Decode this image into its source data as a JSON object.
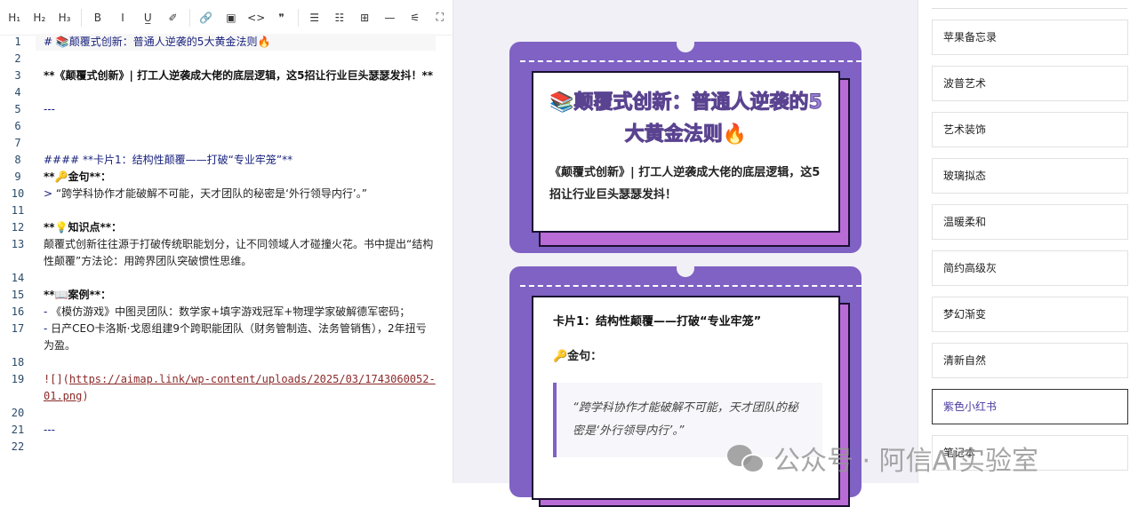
{
  "toolbar": [
    {
      "name": "h1-button",
      "label": "H₁"
    },
    {
      "name": "h2-button",
      "label": "H₂"
    },
    {
      "name": "h3-button",
      "label": "H₃"
    },
    {
      "sep": true
    },
    {
      "name": "bold-button",
      "label": "B"
    },
    {
      "name": "italic-button",
      "label": "I"
    },
    {
      "name": "underline-button",
      "label": "U̲"
    },
    {
      "name": "strikethrough-button",
      "label": "✐"
    },
    {
      "sep": true
    },
    {
      "name": "link-button",
      "label": "🔗"
    },
    {
      "name": "image-button",
      "label": "▣"
    },
    {
      "name": "code-button",
      "label": "<>"
    },
    {
      "name": "quote-button",
      "label": "❞"
    },
    {
      "sep": true
    },
    {
      "name": "bullet-list-button",
      "label": "☰"
    },
    {
      "name": "ordered-list-button",
      "label": "☷"
    },
    {
      "name": "table-button",
      "label": "⊞"
    },
    {
      "name": "divider-button",
      "label": "—"
    },
    {
      "name": "settings-button",
      "label": "⚟"
    },
    {
      "name": "fullscreen-button",
      "label": "⛶"
    }
  ],
  "editor_lines": [
    {
      "num": "1",
      "parts": [
        {
          "c": "h",
          "t": "# 📚颠覆式创新：普通人逆袭的5大黄金法则🔥"
        }
      ],
      "cur": true
    },
    {
      "num": "2",
      "parts": []
    },
    {
      "num": "3",
      "parts": [
        {
          "c": "b",
          "t": "**《颠覆式创新》| 打工人逆袭成大佬的底层逻辑，这5招让行业巨头瑟瑟发抖！**"
        }
      ]
    },
    {
      "num": "4",
      "parts": []
    },
    {
      "num": "5",
      "parts": [
        {
          "c": "hr",
          "t": "---"
        }
      ]
    },
    {
      "num": "6",
      "parts": []
    },
    {
      "num": "7",
      "parts": []
    },
    {
      "num": "8",
      "parts": [
        {
          "c": "h",
          "t": "#### **卡片1：结构性颠覆——打破“专业牢笼”**"
        }
      ]
    },
    {
      "num": "9",
      "parts": [
        {
          "c": "b",
          "t": "**🔑金句**："
        }
      ]
    },
    {
      "num": "10",
      "parts": [
        {
          "c": "h",
          "t": "> "
        },
        {
          "c": "q",
          "t": "“跨学科协作才能破解不可能，天才团队的秘密是‘外行领导内行’。”"
        }
      ]
    },
    {
      "num": "11",
      "parts": []
    },
    {
      "num": "12",
      "parts": [
        {
          "c": "b",
          "t": "**💡知识点**："
        }
      ]
    },
    {
      "num": "13",
      "parts": [
        {
          "c": "q",
          "t": "颠覆式创新往往源于打破传统职能划分，让不同领域人才碰撞火花。书中提出“结构性颠覆”方法论：用跨界团队突破惯性思维。"
        }
      ]
    },
    {
      "num": "14",
      "parts": []
    },
    {
      "num": "15",
      "parts": [
        {
          "c": "b",
          "t": "**📖案例**："
        }
      ]
    },
    {
      "num": "16",
      "parts": [
        {
          "c": "h",
          "t": "- "
        },
        {
          "c": "q",
          "t": "《模仿游戏》中图灵团队：数学家+填字游戏冠军+物理学家破解德军密码；"
        }
      ]
    },
    {
      "num": "17",
      "parts": [
        {
          "c": "h",
          "t": "- "
        },
        {
          "c": "q",
          "t": "日产CEO卡洛斯·戈恩组建9个跨职能团队（财务管制造、法务管销售），2年扭亏为盈。"
        }
      ]
    },
    {
      "num": "18",
      "parts": []
    },
    {
      "num": "19",
      "parts": [
        {
          "c": "urlp",
          "t": "![]("
        },
        {
          "c": "url",
          "t": "https://aimap.link/wp-content/uploads/2025/03/1743060052-01.png"
        },
        {
          "c": "urlp",
          "t": ")"
        }
      ]
    },
    {
      "num": "20",
      "parts": []
    },
    {
      "num": "21",
      "parts": [
        {
          "c": "hr",
          "t": "---"
        }
      ]
    },
    {
      "num": "22",
      "parts": []
    }
  ],
  "preview": {
    "card1": {
      "title": "📚颠覆式创新：普通人逆袭的5大黄金法则🔥",
      "subtitle": "《颠覆式创新》| 打工人逆袭成大佬的底层逻辑，这5招让行业巨头瑟瑟发抖！"
    },
    "card2": {
      "title": "卡片1：结构性颠覆——打破“专业牢笼”",
      "gold_label": "🔑金句：",
      "quote": "“跨学科协作才能破解不可能，天才团队的秘密是‘外行领导内行’。”"
    }
  },
  "styles": [
    "苹果备忘录",
    "波普艺术",
    "艺术装饰",
    "玻璃拟态",
    "温暖柔和",
    "简约高级灰",
    "梦幻渐变",
    "清新自然",
    "紫色小红书",
    "笔记本"
  ],
  "selected_style": "紫色小红书",
  "watermark": "公众号 · 阿信AI实验室",
  "colors": {
    "card": "#7f62c4",
    "shadow": "#b96bd6",
    "selected": "#4a3aa0"
  }
}
